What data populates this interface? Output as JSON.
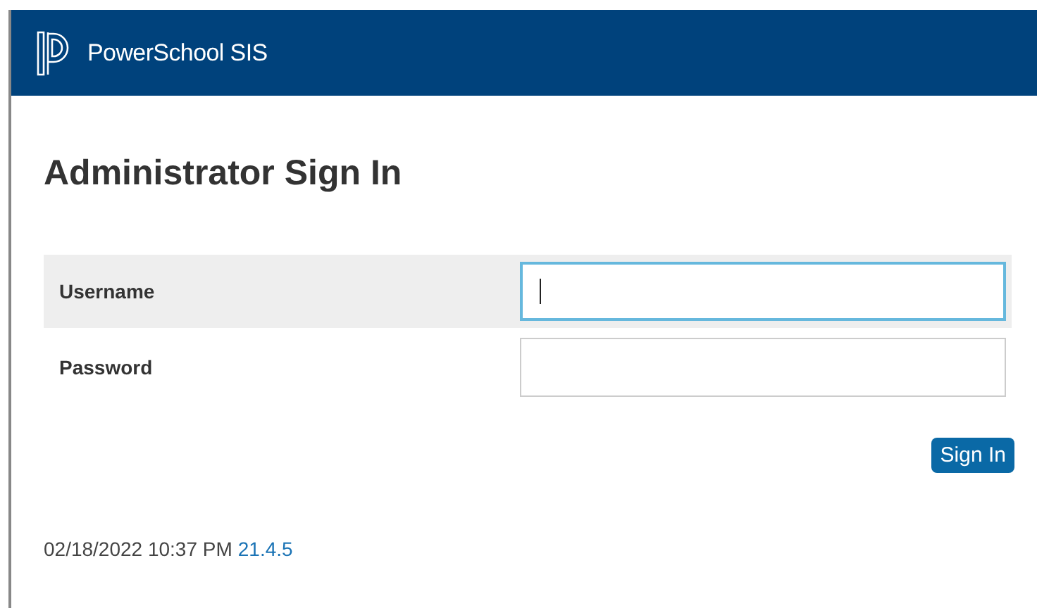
{
  "header": {
    "product": "PowerSchool SIS"
  },
  "title": "Administrator Sign In",
  "fields": [
    {
      "label": "Username",
      "focused": true
    },
    {
      "label": "Password",
      "focused": false
    }
  ],
  "submit": "Sign In",
  "footer": {
    "timestamp": "02/18/2022 10:37 PM",
    "version": "21.4.5"
  }
}
